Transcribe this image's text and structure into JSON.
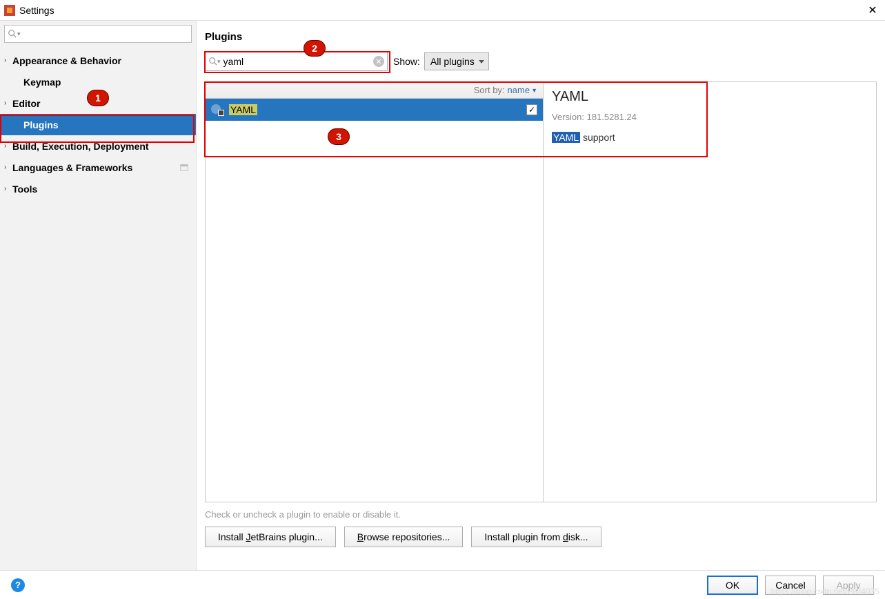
{
  "window": {
    "title": "Settings"
  },
  "sidebar": {
    "items": [
      {
        "label": "Appearance & Behavior"
      },
      {
        "label": "Keymap"
      },
      {
        "label": "Editor"
      },
      {
        "label": "Plugins"
      },
      {
        "label": "Build, Execution, Deployment"
      },
      {
        "label": "Languages & Frameworks"
      },
      {
        "label": "Tools"
      }
    ]
  },
  "content": {
    "title": "Plugins",
    "search_value": "yaml",
    "show_label": "Show:",
    "show_value": "All plugins",
    "sort_label": "Sort by:",
    "sort_value": "name",
    "hint": "Check or uncheck a plugin to enable or disable it.",
    "buttons": {
      "install_jb": "Install JetBrains plugin...",
      "browse": "Browse repositories...",
      "install_disk": "Install plugin from disk..."
    }
  },
  "plugin_list": [
    {
      "name": "YAML",
      "checked": true
    }
  ],
  "detail": {
    "name": "YAML",
    "version_label": "Version: 181.5281.24",
    "highlight": "YAML",
    "desc_rest": " support"
  },
  "footer": {
    "ok": "OK",
    "cancel": "Cancel",
    "apply": "Apply"
  },
  "badges": {
    "b1": "1",
    "b2": "2",
    "b3": "3"
  }
}
